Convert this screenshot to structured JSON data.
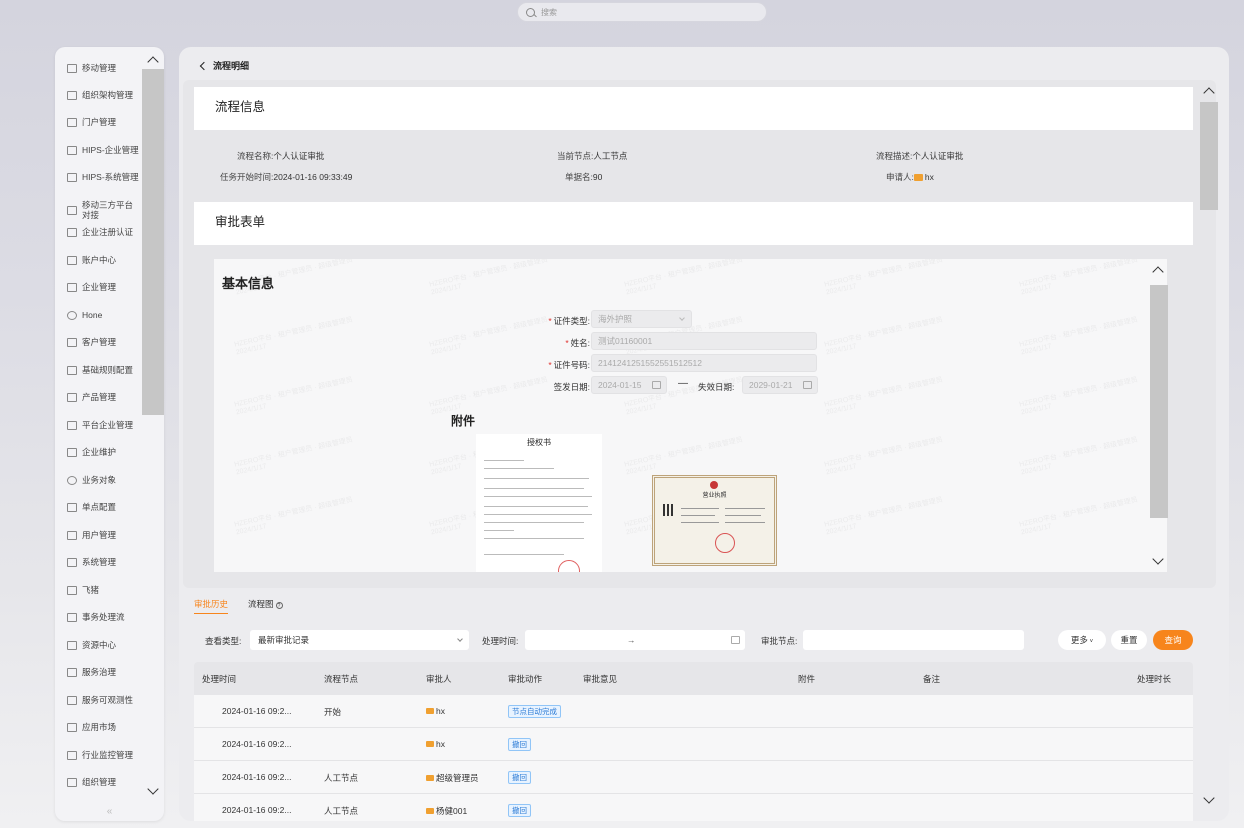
{
  "search": {
    "placeholder": "搜索"
  },
  "sidebar": {
    "items": [
      {
        "label": "移动管理",
        "icon": "grid-icon"
      },
      {
        "label": "组织架构管理",
        "icon": "grid-icon"
      },
      {
        "label": "门户管理",
        "icon": "table-icon"
      },
      {
        "label": "HIPS-企业管理",
        "icon": "building-icon"
      },
      {
        "label": "HIPS-系统管理",
        "icon": "edit-icon"
      },
      {
        "label": "移动三方平台对接",
        "icon": "building-icon"
      },
      {
        "label": "企业注册认证",
        "icon": "grid-icon"
      },
      {
        "label": "账户中心",
        "icon": "grid-icon"
      },
      {
        "label": "企业管理",
        "icon": "grid-icon"
      },
      {
        "label": "Hone",
        "icon": "gear-icon"
      },
      {
        "label": "客户管理",
        "icon": "grid-icon"
      },
      {
        "label": "基础规则配置",
        "icon": "grid-icon"
      },
      {
        "label": "产品管理",
        "icon": "grid-icon"
      },
      {
        "label": "平台企业管理",
        "icon": "grid-icon"
      },
      {
        "label": "企业维护",
        "icon": "grid-icon"
      },
      {
        "label": "业务对象",
        "icon": "target-icon"
      },
      {
        "label": "单点配置",
        "icon": "grid-icon"
      },
      {
        "label": "用户管理",
        "icon": "grid-icon"
      },
      {
        "label": "系统管理",
        "icon": "camera-icon"
      },
      {
        "label": "飞猪",
        "icon": "grid-icon"
      },
      {
        "label": "事务处理流",
        "icon": "grid-icon"
      },
      {
        "label": "资源中心",
        "icon": "cube-icon"
      },
      {
        "label": "服务治理",
        "icon": "grid-icon"
      },
      {
        "label": "服务可观测性",
        "icon": "grid-icon"
      },
      {
        "label": "应用市场",
        "icon": "cube-icon"
      },
      {
        "label": "行业监控管理",
        "icon": "grid-icon"
      },
      {
        "label": "组织管理",
        "icon": "org-icon"
      }
    ],
    "collapse_symbol": "«"
  },
  "page": {
    "title": "流程明细"
  },
  "process_info": {
    "heading": "流程信息",
    "name_label": "流程名称:",
    "name_value": "个人认证审批",
    "node_label": "当前节点:",
    "node_value": "人工节点",
    "desc_label": "流程描述:",
    "desc_value": "个人认证审批",
    "start_label": "任务开始时间:",
    "start_value": "2024-01-16 09:33:49",
    "form_no_label": "单据名:",
    "form_no_value": "90",
    "applicant_label": "申请人:",
    "applicant_value": "hx"
  },
  "approval_form": {
    "heading": "审批表单",
    "basic_title": "基本信息",
    "watermark": "HZERO平台 · 租户管理员 · 超级管理员",
    "watermark_date": "2024/1/17",
    "id_type_label": "证件类型:",
    "id_type_value": "海外护照",
    "name_label": "姓名:",
    "name_value": "测试01160001",
    "id_no_label": "证件号码:",
    "id_no_value": "2141241251552551512512",
    "issue_label": "签发日期:",
    "issue_value": "2024-01-15",
    "dash": "—",
    "expire_label": "失效日期:",
    "expire_value": "2029-01-21",
    "attach_title": "附件",
    "doc1_title": "授权书",
    "doc2_title": "营业执照"
  },
  "tabs": {
    "history": "审批历史",
    "flowchart": "流程图",
    "help": "?"
  },
  "filters": {
    "view_type_label": "查看类型:",
    "view_type_value": "最新审批记录",
    "process_time_label": "处理时间:",
    "range_arrow": "→",
    "approve_node_label": "审批节点:",
    "more": "更多",
    "reset": "重置",
    "query": "查询"
  },
  "table": {
    "columns": [
      "处理时间",
      "流程节点",
      "审批人",
      "审批动作",
      "审批意见",
      "附件",
      "备注",
      "处理时长"
    ],
    "rows": [
      {
        "time": "2024-01-16 09:2...",
        "node": "开始",
        "approver": "hx",
        "action": "节点自动完成"
      },
      {
        "time": "2024-01-16 09:2...",
        "node": "",
        "approver": "hx",
        "action": "撤回"
      },
      {
        "time": "2024-01-16 09:2...",
        "node": "人工节点",
        "approver": "超级管理员",
        "action": "撤回"
      },
      {
        "time": "2024-01-16 09:2...",
        "node": "人工节点",
        "approver": "杨健001",
        "action": "撤回"
      }
    ]
  },
  "colors": {
    "accent": "#f7851c",
    "tag_blue": "#2b7bd6",
    "required": "#e0302c"
  }
}
